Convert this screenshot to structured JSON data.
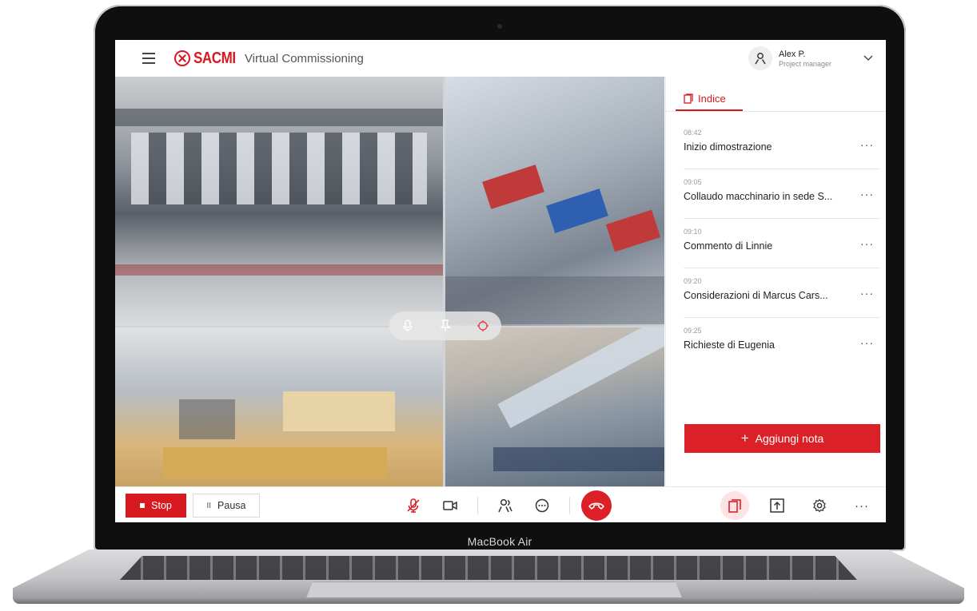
{
  "device": {
    "label": "MacBook Air"
  },
  "header": {
    "logo": "SACMI",
    "app_title": "Virtual Commissioning",
    "user": {
      "name": "Alex P.",
      "role": "Project manager"
    }
  },
  "sidebar": {
    "tab_label": "Indice",
    "notes": [
      {
        "time": "08:42",
        "title": "Inizio dimostrazione"
      },
      {
        "time": "09:05",
        "title": "Collaudo macchinario in sede S..."
      },
      {
        "time": "09:10",
        "title": "Commento di Linnie"
      },
      {
        "time": "09:20",
        "title": "Considerazioni di Marcus Cars..."
      },
      {
        "time": "09:25",
        "title": "Richieste di Eugenia"
      }
    ],
    "note_menu": "···",
    "add_note_label": "Aggiungi nota",
    "add_note_icon": "+"
  },
  "toolbar": {
    "stop_label": "Stop",
    "pause_label": "Pausa",
    "pause_icon": "II",
    "more_label": "···"
  },
  "colors": {
    "accent": "#d71920",
    "accent_light": "#fde3e4",
    "text": "#222222"
  },
  "icons": [
    "hamburger-icon",
    "user-icon",
    "chevron-down-icon",
    "notes-icon",
    "mic-icon",
    "pin-icon",
    "target-icon",
    "mic-off-icon",
    "camera-icon",
    "participants-icon",
    "chat-icon",
    "hangup-icon",
    "upload-icon",
    "gear-icon",
    "more-icon"
  ]
}
